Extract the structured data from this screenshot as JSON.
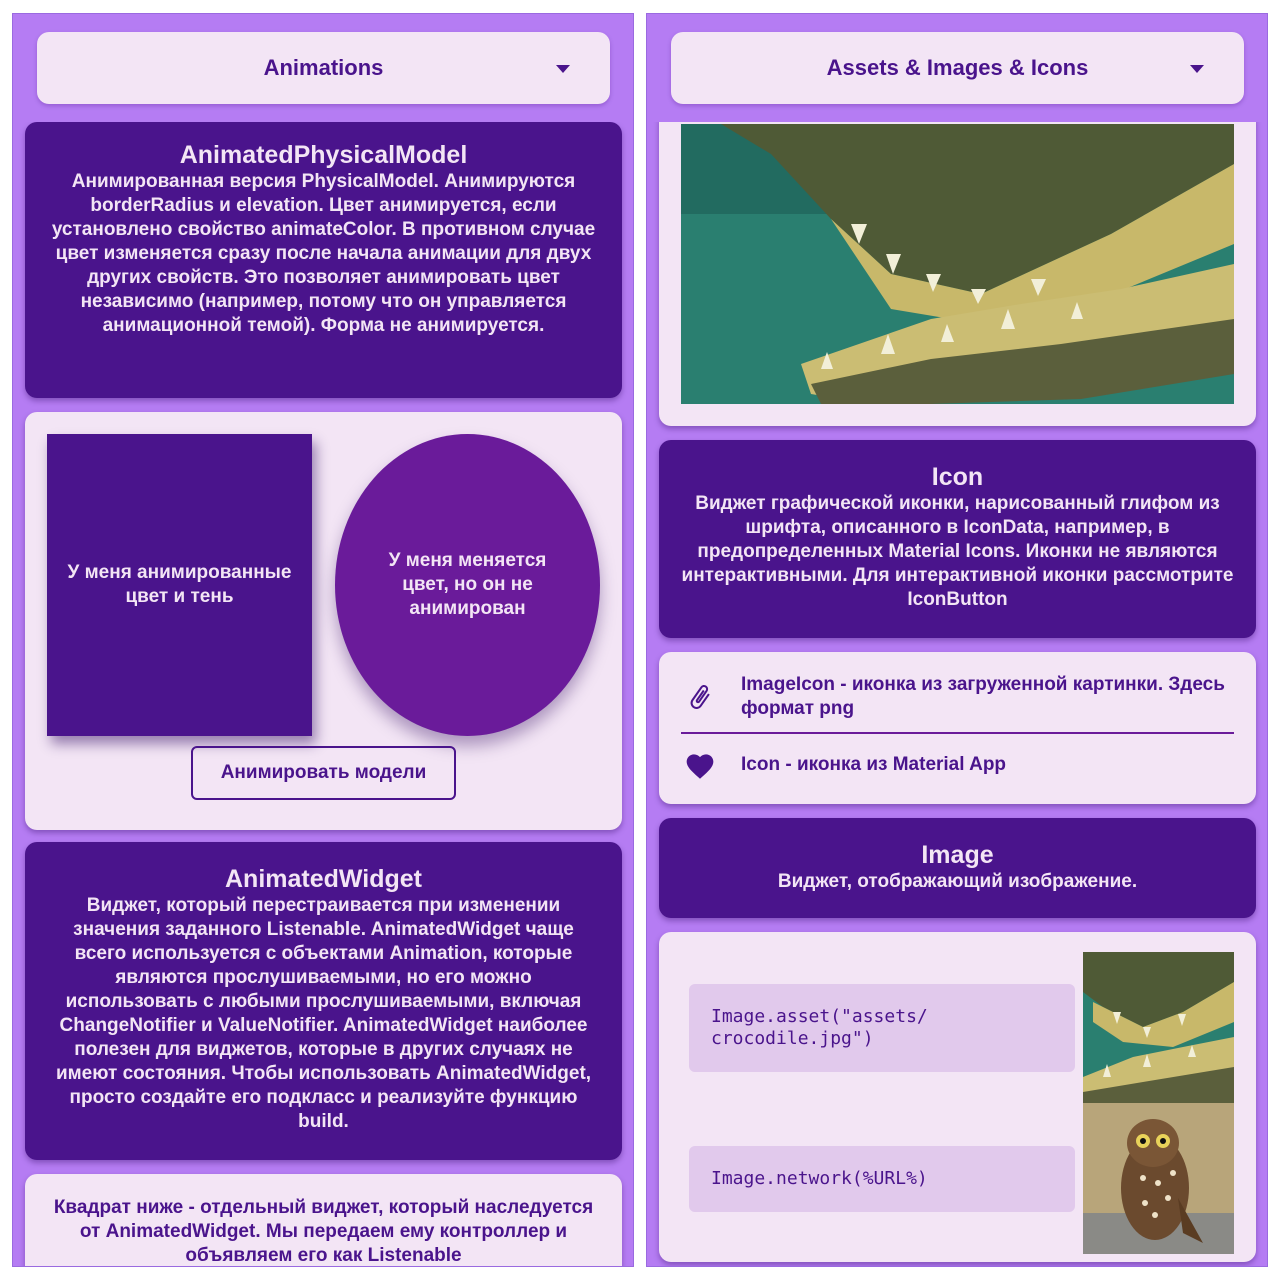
{
  "left": {
    "dropdown": {
      "label": "Animations"
    },
    "cards": {
      "apm": {
        "title": "AnimatedPhysicalModel",
        "body": "Анимированная версия PhysicalModel. Анимируются borderRadius и elevation. Цвет анимируется, если установлено свойство animateColor. В противном случае цвет изменяется сразу после начала анимации для двух других свойств. Это позволяет анимировать цвет независимо (например, потому что он управляется анимационной темой). Форма не анимируется."
      },
      "demo": {
        "square_text": "У меня анимированные цвет и тень",
        "oval_text": "У меня меняется цвет, но он не анимирован",
        "button_label": "Анимировать модели"
      },
      "aw": {
        "title": "AnimatedWidget",
        "body": "Виджет, который перестраивается при изменении значения заданного Listenable. AnimatedWidget чаще всего используется с объектами Animation, которые являются прослушиваемыми, но его можно использовать с любыми прослушиваемыми, включая ChangeNotifier и ValueNotifier. AnimatedWidget наиболее полезен для виджетов, которые в других случаях не имеют состояния. Чтобы использовать AnimatedWidget, просто создайте его подкласс и реализуйте функцию build."
      },
      "note": {
        "body": "Квадрат ниже - отдельный виджет, который наследуется от AnimatedWidget. Мы передаем ему контроллер и объявляем его как Listenable"
      }
    }
  },
  "right": {
    "dropdown": {
      "label": "Assets & Images & Icons"
    },
    "cards": {
      "icon": {
        "title": "Icon",
        "body": "Виджет графической иконки, нарисованный глифом из шрифта, описанного в IconData, например, в предопределенных Material Icons. Иконки не являются интерактивными. Для интерактивной иконки рассмотрите IconButton"
      },
      "icons_list": {
        "row1": {
          "icon": "paperclip-icon",
          "text": "ImageIcon - иконка из загруженной картинки. Здесь формат png"
        },
        "row2": {
          "icon": "heart-icon",
          "text": "Icon - иконка из Material App"
        }
      },
      "image": {
        "title": "Image",
        "body": "Виджет, отображающий изображение."
      },
      "image_demo": {
        "code1": "Image.asset(\"assets/\ncrocodile.jpg\")",
        "code2": "Image.network(%URL%)"
      }
    }
  },
  "colors": {
    "background": "#b57cf3",
    "dark_card": "#4a148c",
    "light_card": "#f3e5f5",
    "oval": "#6a1b9a",
    "code_bg": "#e1c9ec"
  }
}
